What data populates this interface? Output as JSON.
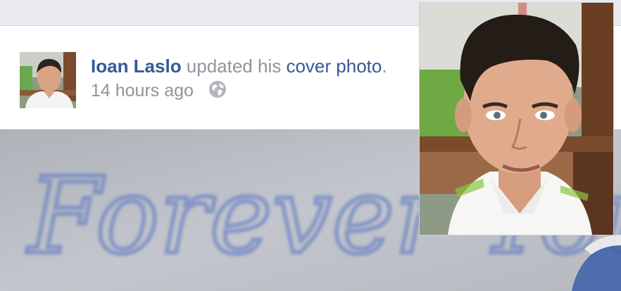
{
  "post": {
    "author_name": "Ioan Laslo",
    "action_text": " updated his ",
    "link_text": "cover photo",
    "end_text": ".",
    "timestamp": "14 hours ago",
    "privacy_icon": "globe-icon"
  },
  "cover": {
    "handwriting_text": "Forever Young"
  },
  "colors": {
    "link": "#365899",
    "meta": "#90949c",
    "background": "#e9ebee"
  }
}
